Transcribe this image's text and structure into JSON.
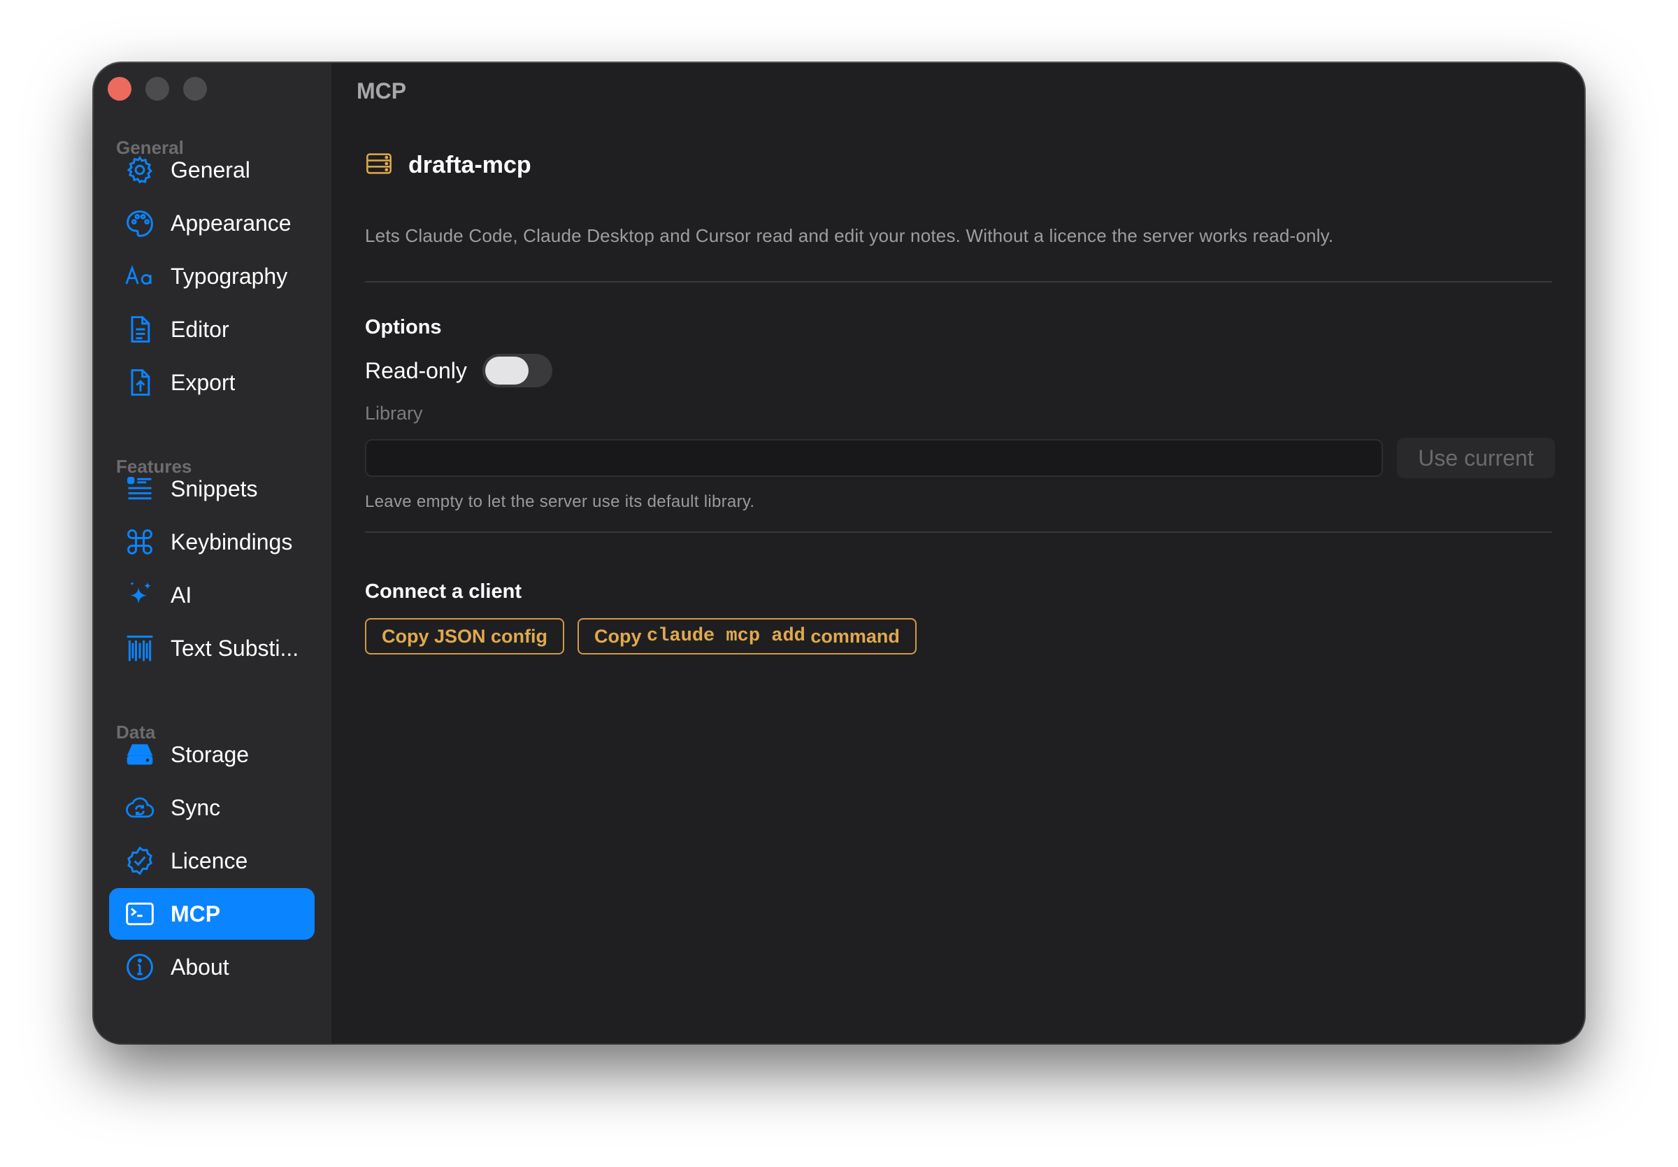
{
  "window": {
    "title": "MCP"
  },
  "sidebar": {
    "sections": [
      {
        "label": "General",
        "items": [
          {
            "label": "General",
            "icon": "gear-icon"
          },
          {
            "label": "Appearance",
            "icon": "palette-icon"
          },
          {
            "label": "Typography",
            "icon": "text-aa-icon"
          },
          {
            "label": "Editor",
            "icon": "document-icon"
          },
          {
            "label": "Export",
            "icon": "document-export-icon"
          }
        ]
      },
      {
        "label": "Features",
        "items": [
          {
            "label": "Snippets",
            "icon": "snippets-list-icon"
          },
          {
            "label": "Keybindings",
            "icon": "command-key-icon"
          },
          {
            "label": "AI",
            "icon": "sparkle-icon"
          },
          {
            "label": "Text Substi...",
            "icon": "text-cursor-icon"
          }
        ]
      },
      {
        "label": "Data",
        "items": [
          {
            "label": "Storage",
            "icon": "drive-icon"
          },
          {
            "label": "Sync",
            "icon": "cloud-sync-icon"
          },
          {
            "label": "Licence",
            "icon": "checkmark-seal-icon"
          },
          {
            "label": "MCP",
            "icon": "terminal-icon",
            "active": true
          },
          {
            "label": "About",
            "icon": "info-icon"
          }
        ]
      }
    ]
  },
  "server": {
    "icon": "server-rack-icon",
    "name": "drafta-mcp",
    "description": "Lets Claude Code, Claude Desktop and Cursor read and edit your notes. Without a licence the server works read-only."
  },
  "options": {
    "heading": "Options",
    "read_only_label": "Read-only",
    "read_only_on": false,
    "library_label": "Library",
    "library_value": "",
    "use_current_label": "Use current",
    "hint": "Leave empty to let the server use its default library."
  },
  "connect": {
    "heading": "Connect a client",
    "copy_json_label": "Copy JSON config",
    "copy_cmd_prefix": "Copy ",
    "copy_cmd_code": "claude mcp add",
    "copy_cmd_suffix": " command"
  },
  "colors": {
    "accent": "#0b84ff",
    "warning_outline": "#d49a46",
    "window_bg": "#1f1f21",
    "sidebar_bg": "#29292b"
  }
}
